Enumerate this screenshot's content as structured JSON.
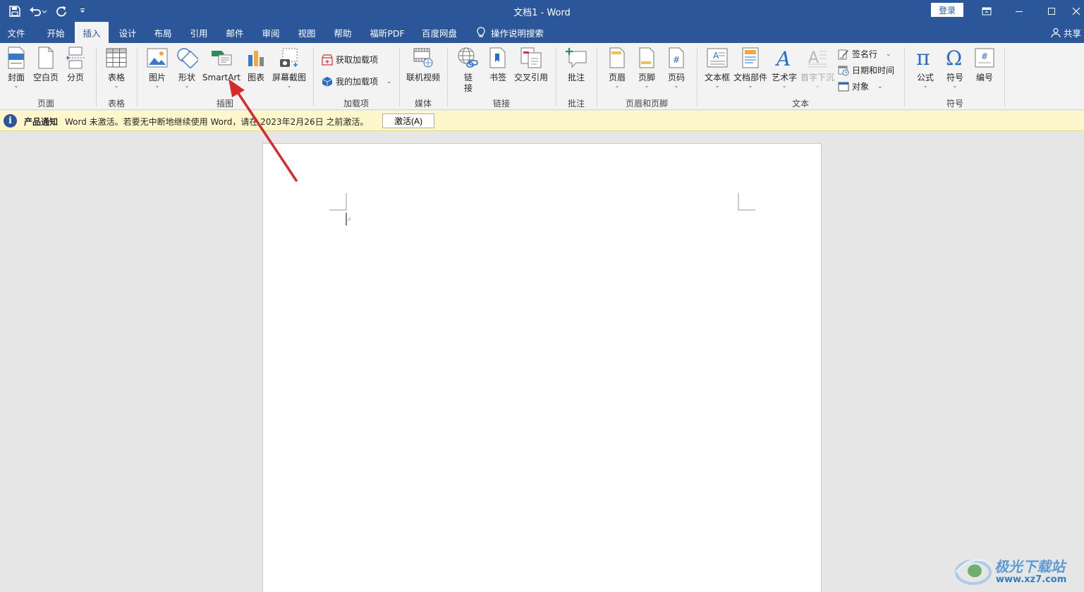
{
  "titlebar": {
    "title": "文档1  -  Word",
    "login": "登录"
  },
  "tabs": [
    {
      "label": "文件"
    },
    {
      "label": "开始"
    },
    {
      "label": "插入",
      "active": true
    },
    {
      "label": "设计"
    },
    {
      "label": "布局"
    },
    {
      "label": "引用"
    },
    {
      "label": "邮件"
    },
    {
      "label": "审阅"
    },
    {
      "label": "视图"
    },
    {
      "label": "帮助"
    },
    {
      "label": "福昕PDF"
    },
    {
      "label": "百度网盘"
    }
  ],
  "tellme": "操作说明搜索",
  "share": "共享",
  "ribbon": {
    "pages": {
      "label": "页面",
      "cover": "封面",
      "blank": "空白页",
      "break": "分页"
    },
    "tables": {
      "label": "表格",
      "table": "表格"
    },
    "illustrations": {
      "label": "插图",
      "picture": "图片",
      "shapes": "形状",
      "smartart": "SmartArt",
      "chart": "图表",
      "screenshot": "屏幕截图"
    },
    "addins": {
      "label": "加载项",
      "get": "获取加载项",
      "mine": "我的加载项"
    },
    "media": {
      "label": "媒体",
      "video": "联机视频"
    },
    "links": {
      "label": "链接",
      "link": "链\n接",
      "bookmark": "书签",
      "crossref": "交叉引用"
    },
    "comments": {
      "label": "批注",
      "comment": "批注"
    },
    "headerfooter": {
      "label": "页眉和页脚",
      "header": "页眉",
      "footer": "页脚",
      "pagenum": "页码"
    },
    "text": {
      "label": "文本",
      "textbox": "文本框",
      "quickparts": "文档部件",
      "wordart": "艺术字",
      "dropcap": "首字下沉",
      "signature": "签名行",
      "datetime": "日期和时间",
      "object": "对象"
    },
    "symbols": {
      "label": "符号",
      "equation": "公式",
      "symbol": "符号",
      "number": "编号"
    }
  },
  "notice": {
    "title": "产品通知",
    "message": "Word 未激活。若要无中断地继续使用 Word，请在 2023年2月26日 之前激活。",
    "button": "激活(A)"
  },
  "watermark": {
    "name": "极光下载站",
    "url": "www.xz7.com"
  },
  "colors": {
    "brand": "#2b579a",
    "ribbon": "#f3f3f3",
    "notice": "#fff7cc",
    "arrow": "#d42b2b"
  }
}
